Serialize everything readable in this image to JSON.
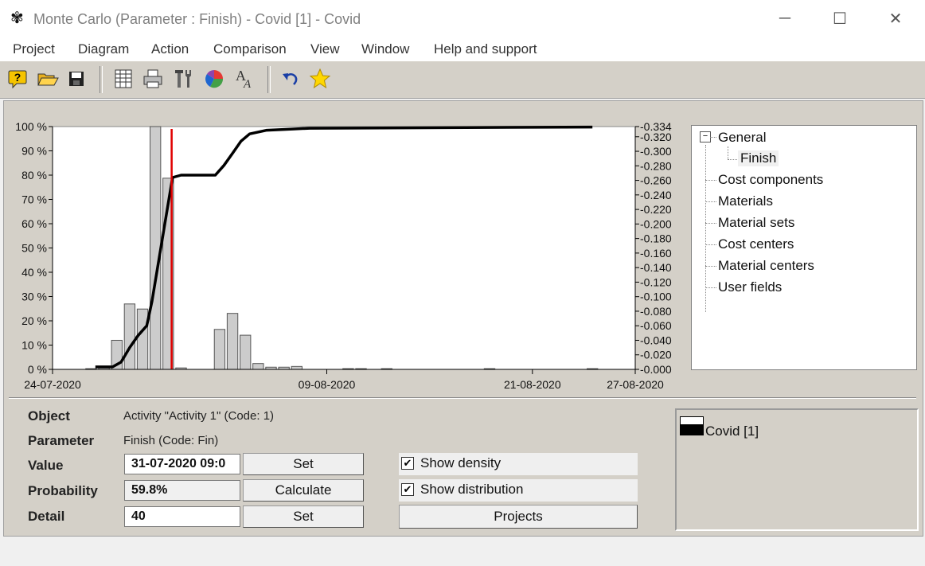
{
  "window": {
    "title": "Monte Carlo (Parameter : Finish) - Covid [1] - Covid",
    "minimize_glyph": "─",
    "maximize_glyph": "☐",
    "close_glyph": "✕"
  },
  "menu": [
    "Project",
    "Diagram",
    "Action",
    "Comparison",
    "View",
    "Window",
    "Help and support"
  ],
  "toolbar": {
    "icons": [
      "help-icon",
      "open-folder-icon",
      "save-icon",
      "table-icon",
      "print-icon",
      "tools-icon",
      "pie-chart-icon",
      "font-icon",
      "undo-icon",
      "favorite-star-icon"
    ],
    "colors": {
      "help": "#f5c400",
      "folder": "#e8b020",
      "star": "#ffd700",
      "undo": "#1a3fa6"
    }
  },
  "chart_data": {
    "type": "bar",
    "left_axis_ticks": [
      "0 %",
      "10 %",
      "20 %",
      "30 %",
      "40 %",
      "50 %",
      "60 %",
      "70 %",
      "80 %",
      "90 %",
      "100 %"
    ],
    "right_axis_ticks": [
      "0.000",
      "0.020",
      "0.040",
      "0.060",
      "0.080",
      "0.100",
      "0.120",
      "0.140",
      "0.160",
      "0.180",
      "0.200",
      "0.220",
      "0.240",
      "0.260",
      "0.280",
      "0.300",
      "0.320",
      "0.334"
    ],
    "x_tick_labels": [
      {
        "label": "24-07-2020",
        "day": 0
      },
      {
        "label": "09-08-2020",
        "day": 16
      },
      {
        "label": "21-08-2020",
        "day": 28
      },
      {
        "label": "27-08-2020",
        "day": 34
      }
    ],
    "ylim_right": [
      0,
      0.334
    ],
    "density_bars": [
      {
        "day": 2.25,
        "density": 0.001
      },
      {
        "day": 3.0,
        "density": 0.002
      },
      {
        "day": 3.75,
        "density": 0.04
      },
      {
        "day": 4.5,
        "density": 0.09
      },
      {
        "day": 5.25,
        "density": 0.083
      },
      {
        "day": 6.0,
        "density": 0.334
      },
      {
        "day": 6.75,
        "density": 0.263
      },
      {
        "day": 7.5,
        "density": 0.002
      },
      {
        "day": 9.75,
        "density": 0.055
      },
      {
        "day": 10.5,
        "density": 0.077
      },
      {
        "day": 11.25,
        "density": 0.047
      },
      {
        "day": 12.0,
        "density": 0.008
      },
      {
        "day": 12.75,
        "density": 0.003
      },
      {
        "day": 13.5,
        "density": 0.003
      },
      {
        "day": 14.25,
        "density": 0.004
      },
      {
        "day": 17.25,
        "density": 0.001
      },
      {
        "day": 18.0,
        "density": 0.001
      },
      {
        "day": 19.5,
        "density": 0.001
      },
      {
        "day": 25.5,
        "density": 0.001
      },
      {
        "day": 31.5,
        "density": 0.001
      }
    ],
    "cumulative": [
      [
        2.5,
        1
      ],
      [
        3.5,
        1
      ],
      [
        4.0,
        3
      ],
      [
        4.5,
        9
      ],
      [
        5.0,
        14
      ],
      [
        5.5,
        18
      ],
      [
        5.8,
        28
      ],
      [
        6.2,
        45
      ],
      [
        6.6,
        62
      ],
      [
        7.0,
        79
      ],
      [
        7.5,
        80
      ],
      [
        8.5,
        80
      ],
      [
        9.5,
        80
      ],
      [
        10.0,
        84
      ],
      [
        10.5,
        89
      ],
      [
        11.0,
        94
      ],
      [
        11.5,
        97
      ],
      [
        12.5,
        98.5
      ],
      [
        14.0,
        99
      ],
      [
        15.0,
        99.3
      ],
      [
        31.5,
        99.8
      ]
    ],
    "marker_day": 6.95,
    "colors": {
      "bar_fill": "#cccccc",
      "bar_stroke": "#555555",
      "line": "#000000",
      "marker": "#e00000"
    }
  },
  "tree": {
    "items": [
      {
        "label": "General",
        "expander": "⊟",
        "level": 0
      },
      {
        "label": "Finish",
        "level": 1,
        "selected": true
      },
      {
        "label": "Cost components",
        "level": 0
      },
      {
        "label": "Materials",
        "level": 0
      },
      {
        "label": "Material sets",
        "level": 0
      },
      {
        "label": "Cost centers",
        "level": 0
      },
      {
        "label": "Material centers",
        "level": 0
      },
      {
        "label": "User fields",
        "level": 0
      }
    ]
  },
  "details": {
    "object_label": "Object",
    "object_value": "Activity \"Activity 1\" (Code: 1)",
    "parameter_label": "Parameter",
    "parameter_value": "Finish (Code: Fin)",
    "value_label": "Value",
    "value_field": "31-07-2020  09:0",
    "value_button": "Set",
    "probability_label": "Probability",
    "probability_field": "59.8%",
    "probability_button": "Calculate",
    "detail_label": "Detail",
    "detail_field": "40",
    "detail_button": "Set"
  },
  "options": {
    "show_density_label": "Show density",
    "show_density_checked": true,
    "show_distribution_label": "Show distribution",
    "show_distribution_checked": true,
    "check_glyph": "✔",
    "projects_button": "Projects"
  },
  "legend": {
    "entries": [
      {
        "label": "Covid [1]"
      }
    ]
  }
}
